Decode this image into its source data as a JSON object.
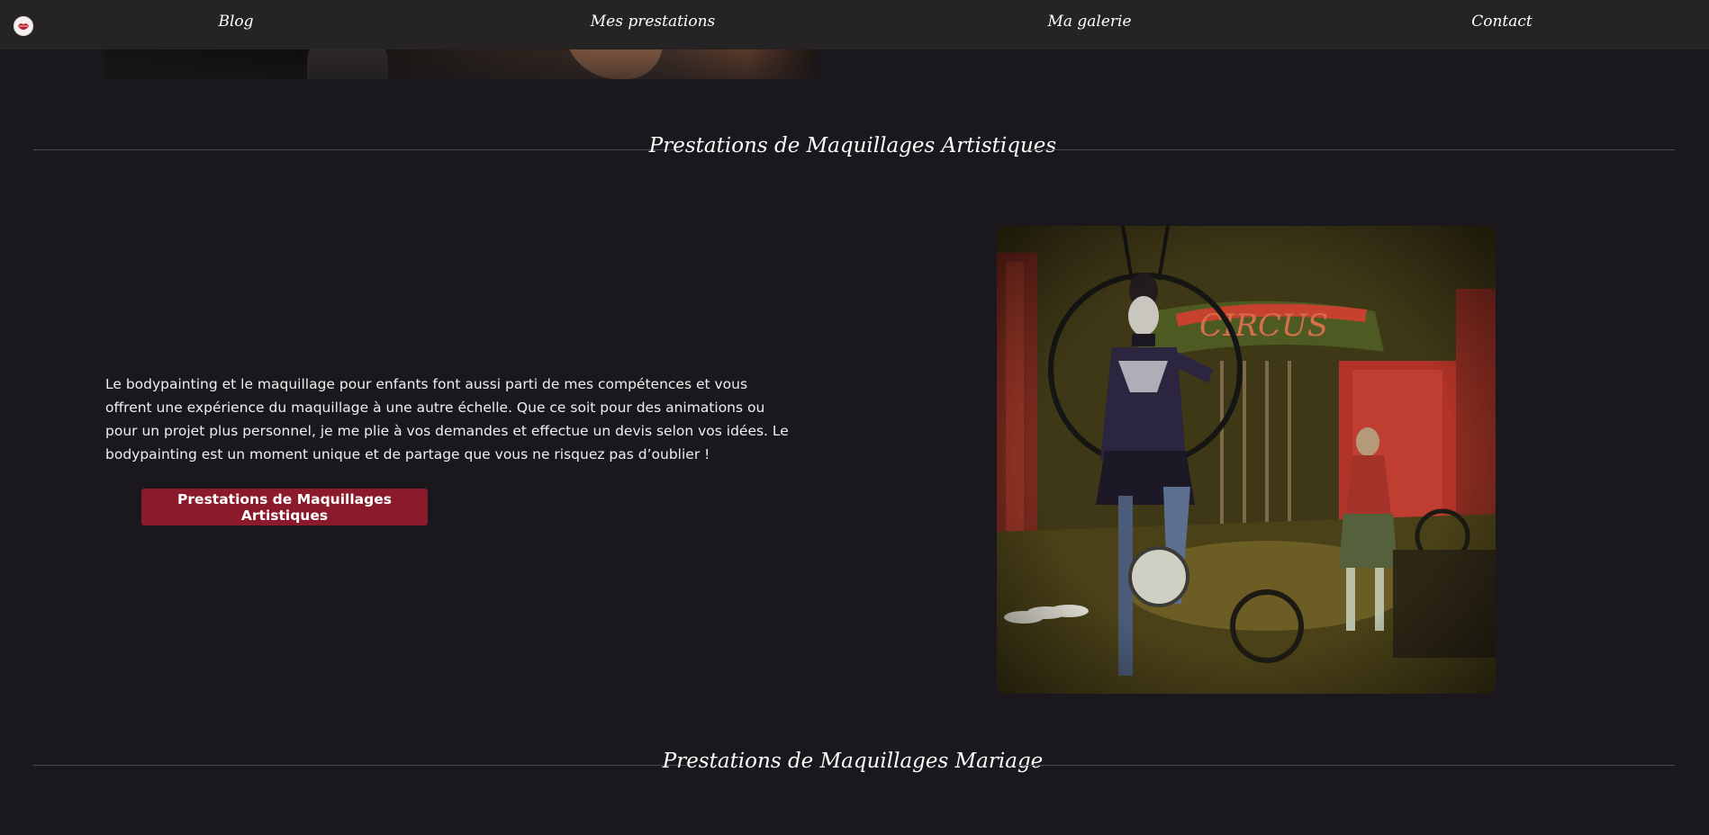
{
  "header": {
    "logo_icon": "brand-logo-icon",
    "nav": [
      {
        "label": "Blog"
      },
      {
        "label": "Mes prestations"
      },
      {
        "label": "Ma galerie"
      },
      {
        "label": "Contact"
      }
    ]
  },
  "section_artistic": {
    "title": "Prestations de Maquillages Artistiques",
    "description": "Le bodypainting et le maquillage pour enfants font aussi parti de mes compétences et vous offrent une expérience du maquillage à une autre échelle. Que ce soit pour des animations ou pour un projet plus personnel, je me plie à vos demandes et effectue un devis selon vos idées. Le bodypainting est un moment unique et de partage que vous ne risquez pas d’oublier !",
    "button_label": "Prestations de Maquillages Artistiques",
    "image_icon": "circus-photo"
  },
  "section_wedding": {
    "title": "Prestations de Maquillages Mariage"
  },
  "colors": {
    "background": "#1a181c",
    "header": "#252324",
    "accent": "#8a1a2c",
    "divider": "#4c494d"
  }
}
